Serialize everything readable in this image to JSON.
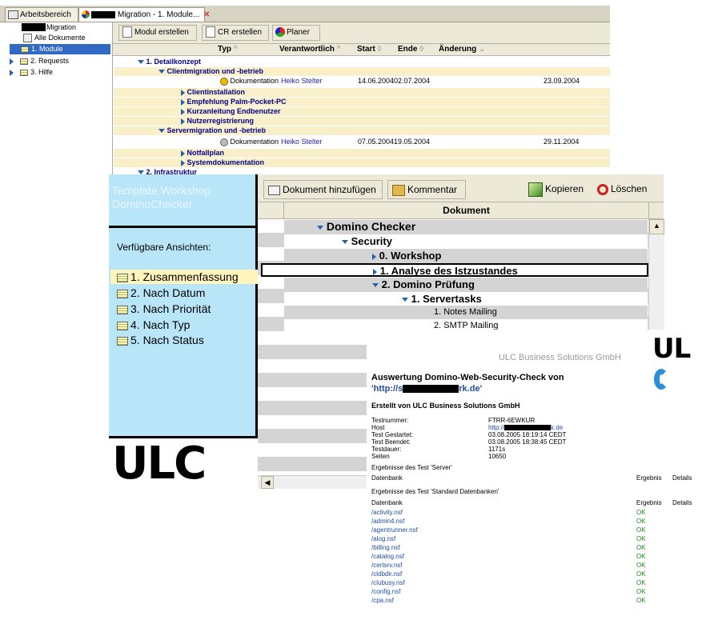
{
  "window1": {
    "tabs": [
      {
        "label": "Arbeitsbereich"
      },
      {
        "label": "Migration - 1. Module..."
      }
    ],
    "sidebar": {
      "items": [
        {
          "label": "Migration"
        },
        {
          "label": "Alle Dokumente"
        },
        {
          "label": "1. Module"
        },
        {
          "label": "2. Requests"
        },
        {
          "label": "3. Hilfe"
        }
      ]
    },
    "toolbar": {
      "buttons": [
        {
          "label": "Modul erstellen"
        },
        {
          "label": "CR erstellen"
        },
        {
          "label": "Planer"
        }
      ]
    },
    "columns": [
      "Typ",
      "Verantwortlich",
      "Start",
      "Ende",
      "Änderung"
    ],
    "rows": [
      {
        "label": "1. Detailkonzept"
      },
      {
        "label": "Clientmigration und -betrieb"
      },
      {
        "typ": "Dokumentation",
        "verantwortlich": "Heiko Stelter",
        "start": "14.06.2004",
        "ende": "02.07.2004",
        "aenderung": "23.09.2004"
      },
      {
        "label": "Clientinstallation"
      },
      {
        "label": "Empfehlung Palm-Pocket-PC"
      },
      {
        "label": "Kurzanleitung Endbenutzer"
      },
      {
        "label": "Nutzerregistrierung"
      },
      {
        "label": "Servermigration und -betrieb"
      },
      {
        "typ": "Dokumentation",
        "verantwortlich": "Heiko Stelter",
        "start": "07.05.2004",
        "ende": "19.05.2004",
        "aenderung": "29.11.2004"
      },
      {
        "label": "Notfallplan"
      },
      {
        "label": "Systemdokumentation"
      },
      {
        "label": "2. Infrastruktur"
      }
    ]
  },
  "window2": {
    "title_line1": "Template Workshop",
    "title_line2": "DominoChecker",
    "views_heading": "Verfügbare Ansichten:",
    "views": [
      {
        "label": "1. Zusammenfassung"
      },
      {
        "label": "2. Nach Datum"
      },
      {
        "label": "3. Nach Priorität"
      },
      {
        "label": "4. Nach Typ"
      },
      {
        "label": "5. Nach Status"
      }
    ],
    "logo_text": "ULC",
    "toolbar": {
      "add_doc": "Dokument hinzufügen",
      "comment": "Kommentar",
      "copy": "Kopieren",
      "delete": "Löschen"
    },
    "column_header": "Dokument",
    "rows": [
      {
        "label": "Domino Checker"
      },
      {
        "label": "Security"
      },
      {
        "label": "0. Workshop"
      },
      {
        "label": "1. Analyse des Istzustandes"
      },
      {
        "label": "2. Domino Prüfung"
      },
      {
        "label": "1. Servertasks"
      },
      {
        "label": "1. Notes Mailing"
      },
      {
        "label": "2. SMTP Mailing"
      }
    ]
  },
  "report": {
    "company": "ULC Business Solutions GmbH",
    "logo_text": "UL",
    "title": "Auswertung Domino-Web-Security-Check von",
    "url_start": "'http://s",
    "url_end": "rk.de'",
    "created_by": "Erstellt von ULC Business Solutions GmbH",
    "meta": [
      {
        "key": "Testnummer:",
        "value": "FTRR-6EWKUR"
      },
      {
        "key": "Host",
        "value_start": "http://",
        "value_end": "k.de"
      },
      {
        "key": "Test Gestartet:",
        "value": "03.08.2005 18:19:14 CEDT"
      },
      {
        "key": "Test Beendet:",
        "value": "03.08.2005 18:38:45 CEDT"
      },
      {
        "key": "Testdauer:",
        "value": "1171s"
      },
      {
        "key": "Seiten",
        "value": "10650"
      }
    ],
    "section_server": "Ergebnisse des Test 'Server'",
    "col_datenbank": "Datenbank",
    "col_ergebnis": "Ergebnis",
    "col_details": "Details",
    "section_std": "Ergebnisse des Test 'Standard Datenbanken'",
    "databases": [
      {
        "name": "/activity.nsf",
        "result": "OK"
      },
      {
        "name": "/admin4.nsf",
        "result": "OK"
      },
      {
        "name": "/agentrunner.nsf",
        "result": "OK"
      },
      {
        "name": "/alog.nsf",
        "result": "OK"
      },
      {
        "name": "/billing.nsf",
        "result": "OK"
      },
      {
        "name": "/catalog.nsf",
        "result": "OK"
      },
      {
        "name": "/certsrv.nsf",
        "result": "OK"
      },
      {
        "name": "/cldbdir.nsf",
        "result": "OK"
      },
      {
        "name": "/clubusy.nsf",
        "result": "OK"
      },
      {
        "name": "/config.nsf",
        "result": "OK"
      },
      {
        "name": "/cpa.nsf",
        "result": "OK"
      }
    ]
  }
}
